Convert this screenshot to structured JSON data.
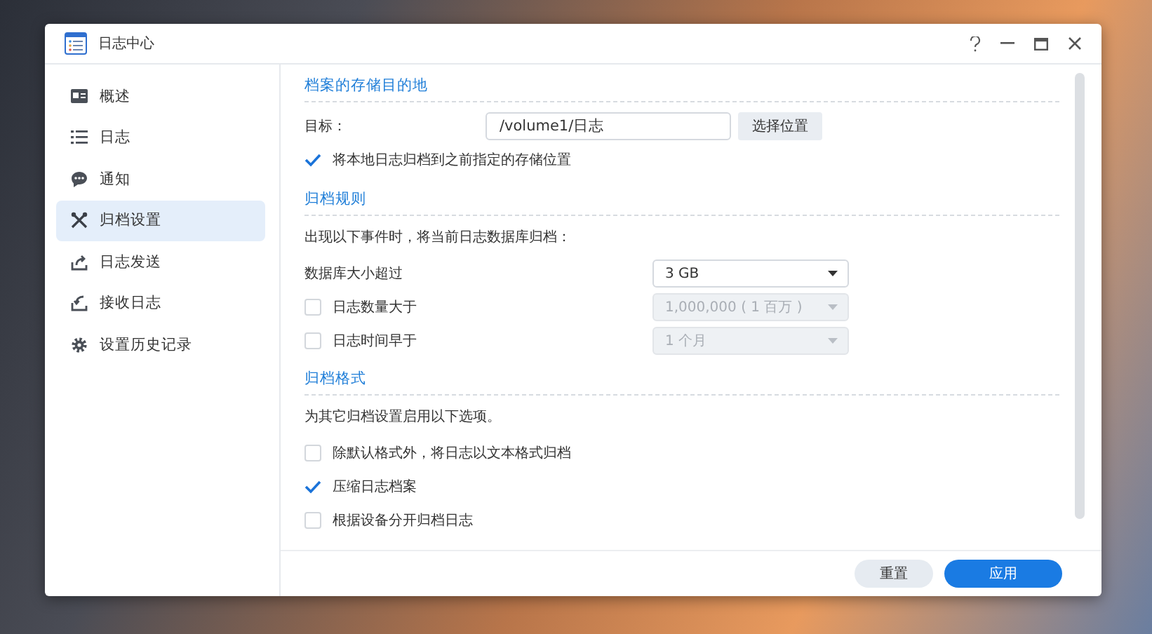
{
  "window": {
    "title": "日志中心"
  },
  "sidebar": {
    "items": [
      {
        "label": "概述",
        "selected": false
      },
      {
        "label": "日志",
        "selected": false
      },
      {
        "label": "通知",
        "selected": false
      },
      {
        "label": "归档设置",
        "selected": true
      },
      {
        "label": "日志发送",
        "selected": false
      },
      {
        "label": "接收日志",
        "selected": false
      },
      {
        "label": "设置历史记录",
        "selected": false
      }
    ]
  },
  "destination": {
    "title": "档案的存储目的地",
    "target_label": "目标：",
    "target_value": "/volume1/日志",
    "browse_button": "选择位置",
    "archive_local": {
      "label": "将本地日志归档到之前指定的存储位置",
      "checked": true
    }
  },
  "rules": {
    "title": "归档规则",
    "description": "出现以下事件时，将当前日志数据库归档：",
    "rows": [
      {
        "kind": "plain",
        "label": "数据库大小超过",
        "value": "3 GB",
        "disabled": false
      },
      {
        "kind": "checkbox",
        "label": "日志数量大于",
        "checked": false,
        "value": "1,000,000 ( 1 百万 )",
        "disabled": true
      },
      {
        "kind": "checkbox",
        "label": "日志时间早于",
        "checked": false,
        "value": "1 个月",
        "disabled": true
      }
    ]
  },
  "format": {
    "title": "归档格式",
    "description": "为其它归档设置启用以下选项。",
    "options": [
      {
        "label": "除默认格式外，将日志以文本格式归档",
        "checked": false
      },
      {
        "label": "压缩日志档案",
        "checked": true
      },
      {
        "label": "根据设备分开归档日志",
        "checked": false
      }
    ]
  },
  "buttons": [
    {
      "label": "重置",
      "kind": "secondary"
    },
    {
      "label": "应用",
      "kind": "primary"
    }
  ]
}
